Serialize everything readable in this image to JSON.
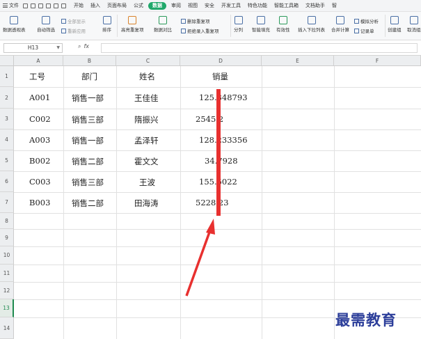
{
  "ribbon_tabs": {
    "file": "文件",
    "tabs": [
      "开始",
      "插入",
      "页面布局",
      "公式",
      "数据",
      "审阅",
      "视图",
      "安全",
      "开发工具",
      "特色功能",
      "智能工具箱",
      "文档助手",
      "智"
    ],
    "active": "数据"
  },
  "ribbon_tools": {
    "pivot": "数据透视表",
    "autofilter": "自动筛选",
    "show_all": "全部显示",
    "reapply": "重新应用",
    "sort": "排序",
    "highlight_dup": "高亮重复项",
    "compare": "数据对比",
    "remove_dup": "删除重复项",
    "reject_dup": "拒绝录入重复项",
    "split": "分列",
    "fill": "智能填充",
    "validity": "有效性",
    "dropdown": "插入下拉列表",
    "consolidate": "合并计算",
    "simulate": "模拟分析",
    "record": "记录单",
    "group": "创建组",
    "ungroup": "取消组"
  },
  "formula_bar": {
    "cell_ref": "H13",
    "fx_label": "fx",
    "formula": ""
  },
  "sheet": {
    "columns": [
      "A",
      "B",
      "C",
      "D",
      "E",
      "F"
    ],
    "rows": [
      "1",
      "2",
      "3",
      "4",
      "5",
      "6",
      "7",
      "8",
      "9",
      "10",
      "11",
      "12",
      "13",
      "14"
    ],
    "selected_row": "13",
    "headers": [
      "工号",
      "部门",
      "姓名",
      "销量"
    ],
    "data": [
      [
        "A001",
        "销售一部",
        "王佳佳",
        "125.348793"
      ],
      [
        "C002",
        "销售三部",
        "隋振兴",
        "2545.2"
      ],
      [
        "A003",
        "销售一部",
        "孟泽轩",
        "128.233356"
      ],
      [
        "B002",
        "销售二部",
        "霍文文",
        "34.7928"
      ],
      [
        "C003",
        "销售三部",
        "王波",
        "155.5022"
      ],
      [
        "B003",
        "销售二部",
        "田海涛",
        "5228.23"
      ]
    ]
  },
  "annotation": {
    "color": "#e8302f"
  },
  "watermark": "最需教育",
  "colors": {
    "active_tab": "#20a86b",
    "selected_row": "#1e8a4f",
    "watermark": "#2c3e9a"
  }
}
